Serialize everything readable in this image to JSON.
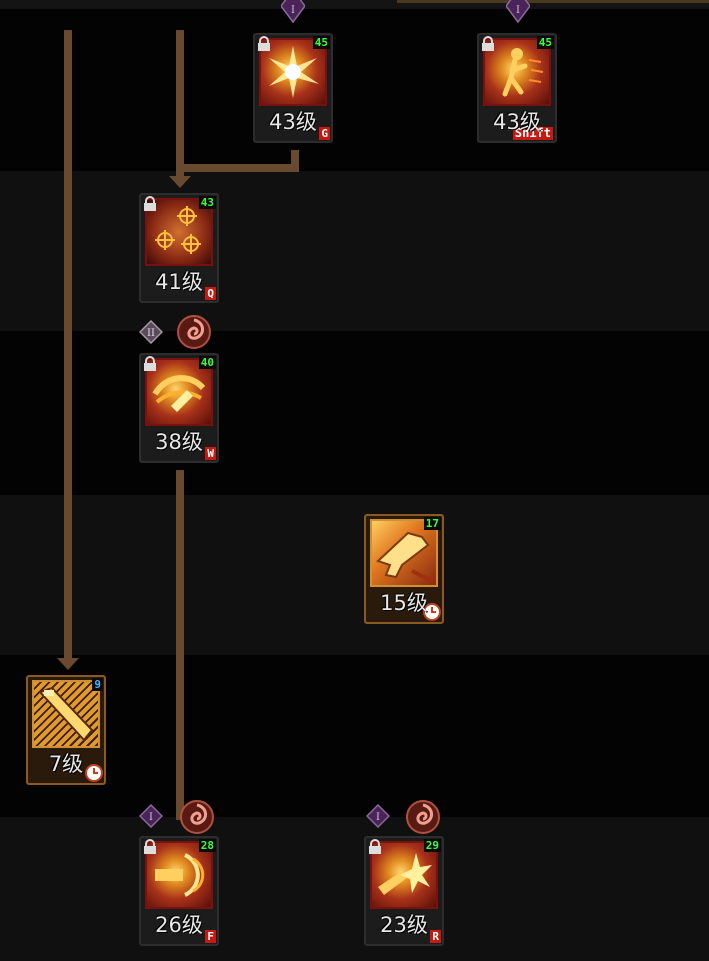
{
  "colors": {
    "connector": "#6a4a2e",
    "required_level_locked": "#3cff3c",
    "required_level_learned": "#4ab0ff",
    "key_badge_bg": "#c41a10",
    "tier_diamond": "#5a2a6a"
  },
  "skills": [
    {
      "id": "g-skill",
      "level_text": "43级",
      "required_level": "45",
      "hotkey": "G",
      "locked": true,
      "tier": "I",
      "swirl": false,
      "icon": "burst-explosion-icon"
    },
    {
      "id": "shift-skill",
      "level_text": "43级",
      "required_level": "45",
      "hotkey": "Shift",
      "locked": true,
      "tier": "I",
      "swirl": false,
      "icon": "figure-dash-icon"
    },
    {
      "id": "q-skill",
      "level_text": "41级",
      "required_level": "43",
      "hotkey": "Q",
      "locked": true,
      "tier": "",
      "swirl": false,
      "icon": "targets-icon"
    },
    {
      "id": "w-skill",
      "level_text": "38级",
      "required_level": "40",
      "hotkey": "W",
      "locked": true,
      "tier": "II",
      "swirl": true,
      "icon": "spinning-blade-icon"
    },
    {
      "id": "pistol-skill",
      "level_text": "15级",
      "required_level": "17",
      "hotkey": "",
      "locked": false,
      "tier": "",
      "swirl": false,
      "icon": "pistol-icon"
    },
    {
      "id": "rifle-skill",
      "level_text": "7级",
      "required_level": "9",
      "hotkey": "",
      "locked": false,
      "tier": "",
      "swirl": false,
      "icon": "rifle-icon"
    },
    {
      "id": "f-skill",
      "level_text": "26级",
      "required_level": "28",
      "hotkey": "F",
      "locked": true,
      "tier": "I",
      "swirl": true,
      "icon": "gatling-icon"
    },
    {
      "id": "r-skill",
      "level_text": "23级",
      "required_level": "29",
      "hotkey": "R",
      "locked": true,
      "tier": "I",
      "swirl": true,
      "icon": "explosion-shot-icon"
    }
  ]
}
